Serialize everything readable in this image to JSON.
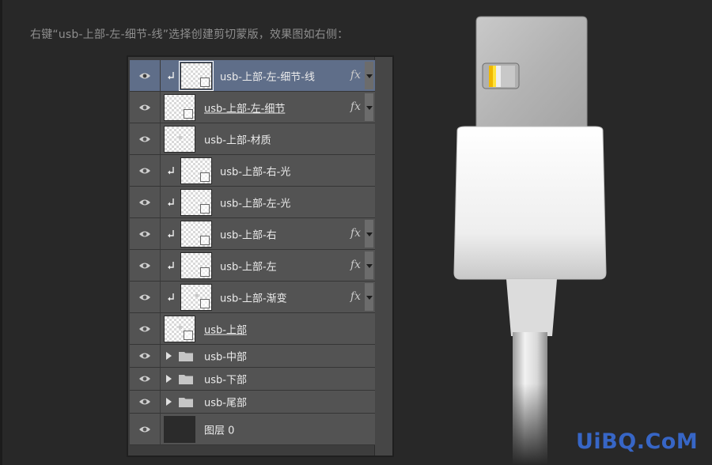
{
  "instruction": "右键“usb-上部-左-细节-线”选择创建剪切蒙版，效果图如右侧：",
  "layers": [
    {
      "name": "usb-上部-左-细节-线",
      "clipped": true,
      "fx": true,
      "selected": true
    },
    {
      "name": "usb-上部-左-细节",
      "clipped": false,
      "fx": true,
      "underline": true
    },
    {
      "name": "usb-上部-材质",
      "clipped": false,
      "fx": false
    },
    {
      "name": "usb-上部-右-光",
      "clipped": true,
      "fx": false
    },
    {
      "name": "usb-上部-左-光",
      "clipped": true,
      "fx": false
    },
    {
      "name": "usb-上部-右",
      "clipped": true,
      "fx": true
    },
    {
      "name": "usb-上部-左",
      "clipped": true,
      "fx": true
    },
    {
      "name": "usb-上部-渐变",
      "clipped": true,
      "fx": true
    },
    {
      "name": "usb-上部",
      "clipped": false,
      "fx": false,
      "underline": true
    }
  ],
  "groups": [
    {
      "name": "usb-中部"
    },
    {
      "name": "usb-下部"
    },
    {
      "name": "usb-尾部"
    }
  ],
  "background_layer": {
    "name": "图层 0"
  },
  "fx_label": "fx",
  "watermark": "UiBQ.CoM",
  "colors": {
    "selected_row": "#5f6e89",
    "row": "#535353",
    "watermark": "#3766c6"
  }
}
